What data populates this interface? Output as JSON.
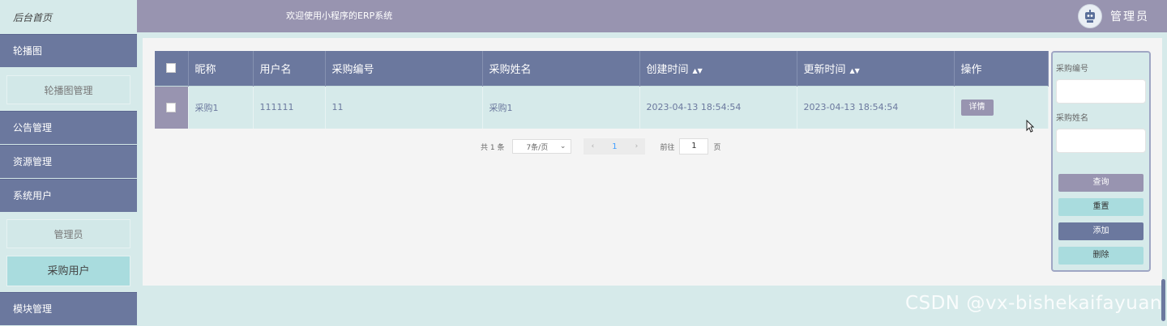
{
  "sidebar": {
    "home": "后台首页",
    "carousel_group": "轮播图",
    "carousel_manage": "轮播图管理",
    "notice_manage": "公告管理",
    "resource_manage": "资源管理",
    "system_users": "系统用户",
    "admin_item": "管理员",
    "purchase_users": "采购用户",
    "module_manage": "模块管理"
  },
  "header": {
    "welcome": "欢迎使用小程序的ERP系统",
    "admin": "管理员"
  },
  "table": {
    "columns": [
      "昵称",
      "用户名",
      "采购编号",
      "采购姓名",
      "创建时间",
      "更新时间",
      "操作"
    ],
    "rows": [
      {
        "nickname": "采购1",
        "username": "111111",
        "purchase_no": "11",
        "purchase_name": "采购1",
        "created": "2023-04-13 18:54:54",
        "updated": "2023-04-13 18:54:54",
        "action": "详情"
      }
    ]
  },
  "pager": {
    "total": "共 1 条",
    "page_size": "7条/页",
    "prev": "‹",
    "current": "1",
    "next": "›",
    "goto_label": "前往",
    "goto_value": "1",
    "goto_unit": "页"
  },
  "search": {
    "no_label": "采购编号",
    "name_label": "采购姓名",
    "query": "查询",
    "reset": "重置",
    "add": "添加",
    "delete": "删除"
  },
  "watermark": "CSDN @vx-bishekaifayuan",
  "colors": {
    "sidebar_group": "#6b789e",
    "header": "#9894b0",
    "row_bg": "#d6eaea",
    "active_item": "#a9dcde"
  }
}
